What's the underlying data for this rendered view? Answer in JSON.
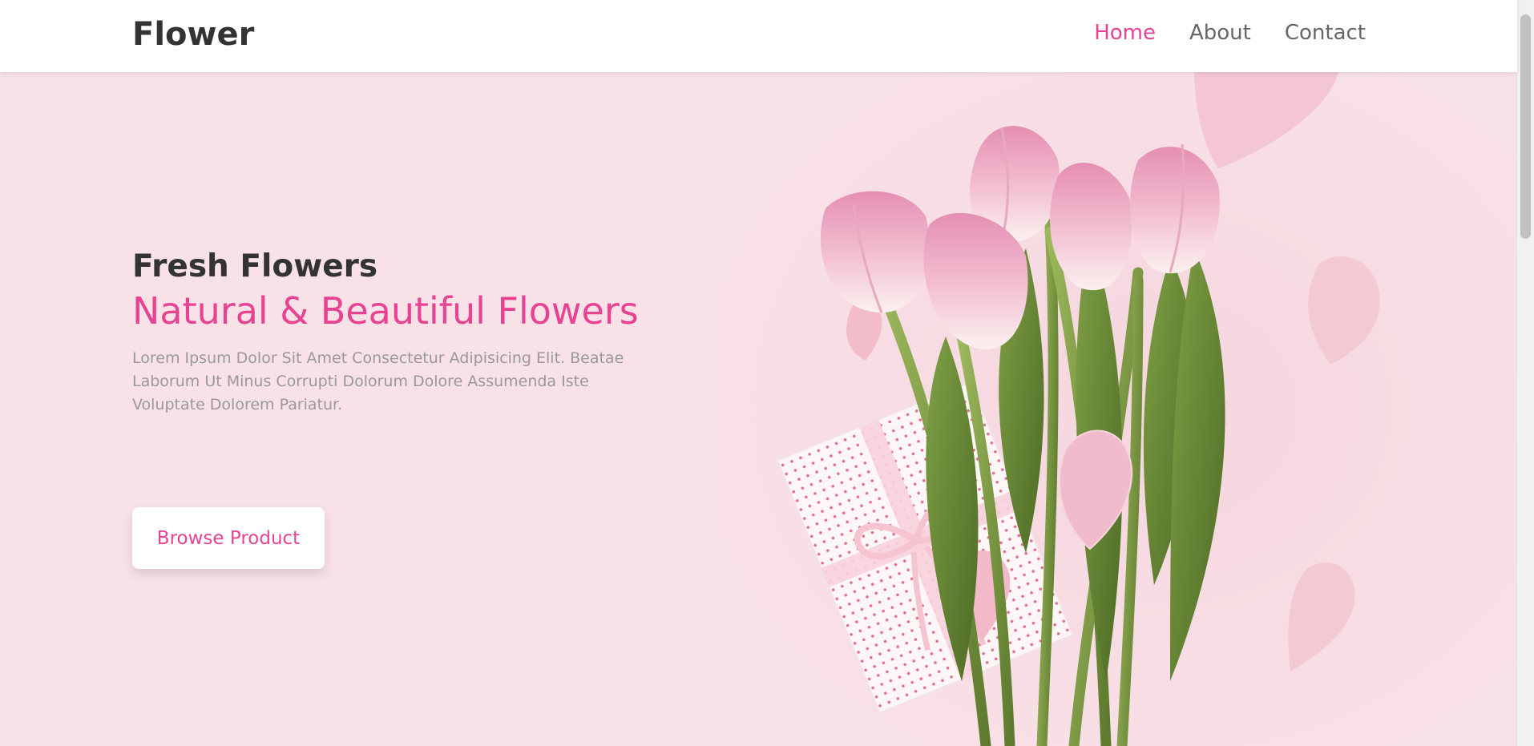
{
  "header": {
    "logo": "Flower",
    "nav": [
      "Home",
      "About",
      "Contact"
    ],
    "active_nav": "Home"
  },
  "hero": {
    "subtitle": "Fresh Flowers",
    "title": "Natural & Beautiful Flowers",
    "description": "Lorem Ipsum Dolor Sit Amet Consectetur Adipisicing Elit. Beatae Laborum Ut Minus Corrupti Dolorum Dolore Assumenda Iste Voluptate Dolorem Pariatur.",
    "button_label": "Browse Product"
  },
  "colors": {
    "accent": "#e84393",
    "background": "#f8e1e7",
    "heading": "#333333",
    "muted": "#999999"
  },
  "icons": {
    "hero_image": "tulips-bouquet-with-gift-box"
  }
}
